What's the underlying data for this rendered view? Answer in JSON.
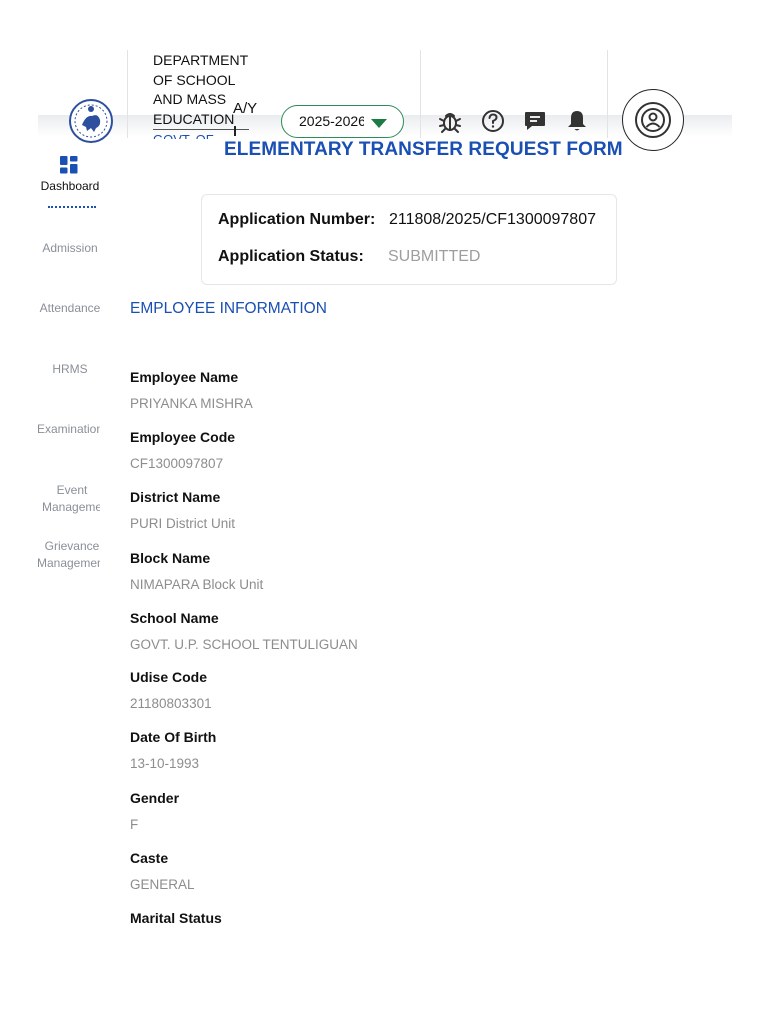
{
  "header": {
    "department": "DEPARTMENT OF SCHOOL AND MASS EDUCATION",
    "department_sub": "GOVT. OF ODISHA",
    "ay_label": "A/Y",
    "academic_year": "2025-2026"
  },
  "icons": {
    "logo": "odisha-emblem-icon",
    "bug": "bug-icon",
    "help": "help-icon",
    "chat": "chat-icon",
    "bell": "bell-icon",
    "profile": "profile-icon",
    "dashboard": "dashboard-grid-icon"
  },
  "colors": {
    "accent": "#1a4fb3",
    "select_border": "#2e8b57",
    "muted": "#8d8d8d"
  },
  "sidebar": {
    "items": [
      {
        "label": "Dashboard"
      },
      {
        "label": "Admission"
      },
      {
        "label": "Attendance"
      },
      {
        "label": "HRMS"
      },
      {
        "label": "Examination"
      },
      {
        "label": "Event Management"
      },
      {
        "label": "Grievance Management"
      }
    ]
  },
  "main": {
    "title": "ELEMENTARY TRANSFER REQUEST FORM",
    "application": {
      "number_label": "Application Number:",
      "number_value": "211808/2025/CF1300097807",
      "status_label": "Application Status:",
      "status_value": "SUBMITTED"
    },
    "section_title": "EMPLOYEE INFORMATION",
    "fields": [
      {
        "label": "Employee Name",
        "value": "PRIYANKA MISHRA"
      },
      {
        "label": "Employee Code",
        "value": "CF1300097807"
      },
      {
        "label": "District Name",
        "value": "PURI District Unit"
      },
      {
        "label": "Block Name",
        "value": "NIMAPARA Block Unit"
      },
      {
        "label": "School Name",
        "value": "GOVT. U.P. SCHOOL TENTULIGUAN"
      },
      {
        "label": "Udise Code",
        "value": "21180803301"
      },
      {
        "label": "Date Of Birth",
        "value": "13-10-1993"
      },
      {
        "label": "Gender",
        "value": "F"
      },
      {
        "label": "Caste",
        "value": "GENERAL"
      },
      {
        "label": "Marital Status",
        "value": ""
      }
    ]
  }
}
